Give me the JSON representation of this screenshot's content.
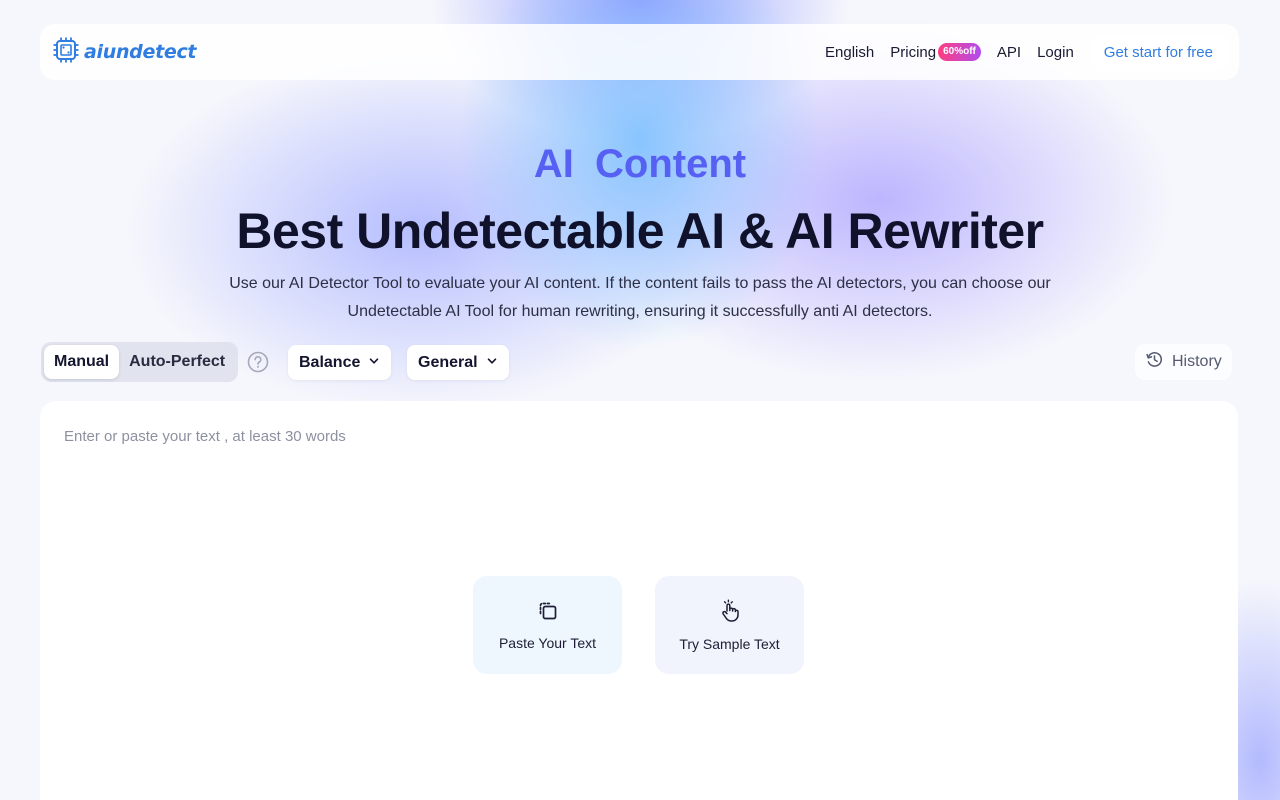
{
  "nav": {
    "logo_text": "aiundetect",
    "links": {
      "language": "English",
      "pricing": "Pricing",
      "pricing_badge": "60%off",
      "api": "API",
      "login": "Login"
    },
    "cta": "Get start for free"
  },
  "hero": {
    "top_line": "AI Content",
    "title": "Best Undetectable AI & AI Rewriter",
    "description_line1": "Use our AI Detector Tool to evaluate your AI content. If the content fails to pass the AI detectors, you can choose our",
    "description_line2": "Undetectable AI Tool for human rewriting, ensuring it successfully anti AI detectors."
  },
  "toolbar": {
    "modes": [
      "Manual",
      "Auto-Perfect"
    ],
    "active_mode": "Manual",
    "strength_select": "Balance",
    "purpose_select": "General",
    "history_label": "History"
  },
  "editor": {
    "placeholder": "Enter or paste your text , at least 30 words",
    "paste_label": "Paste Your Text",
    "sample_label": "Try Sample Text"
  },
  "colors": {
    "brand": "#2f7de1",
    "hero_accent": "#5660f2",
    "badge_from": "#ff3d7f",
    "badge_to": "#b04df0"
  },
  "icons": {
    "logo": "chip-icon",
    "help": "question-circle-icon",
    "dropdown": "chevron-down-icon",
    "history": "history-clock-icon",
    "paste": "paste-icon",
    "sample": "pointer-hand-icon"
  }
}
